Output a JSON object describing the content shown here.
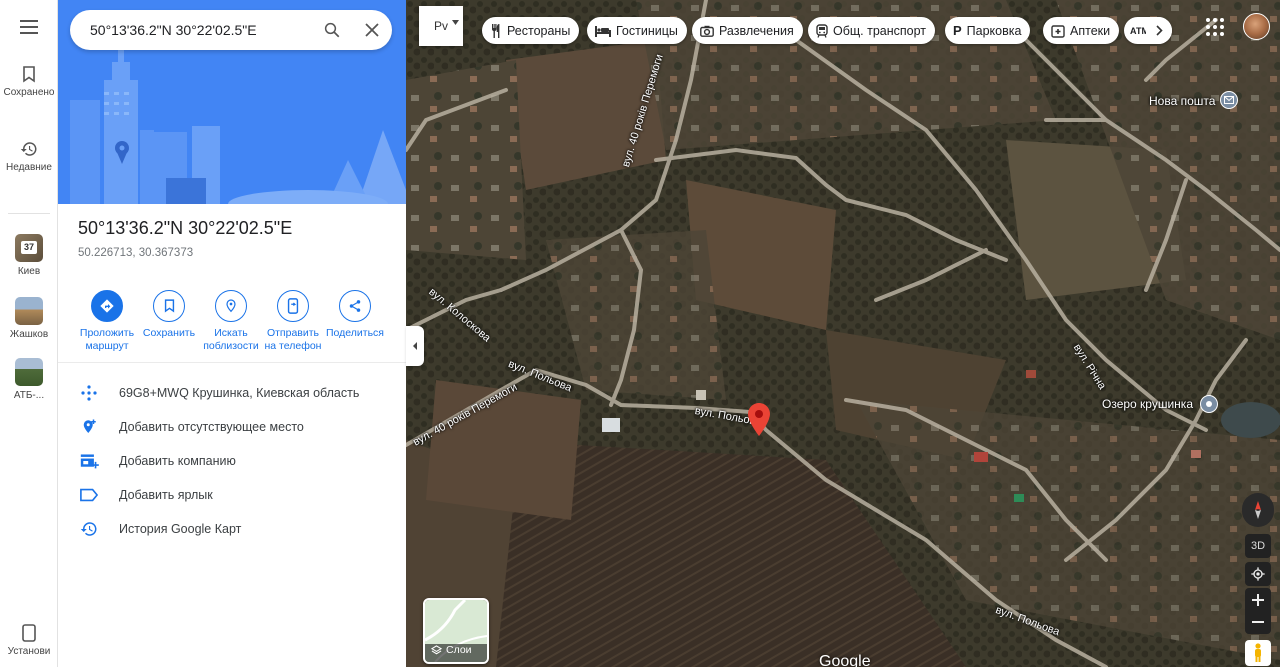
{
  "search": {
    "value": "50°13'36.2\"N 30°22'02.5\"E"
  },
  "rail": {
    "saved_label": "Сохранено",
    "recent_label": "Недавние",
    "history": [
      {
        "label": "Киев",
        "badge": "37"
      },
      {
        "label": "Жашков"
      },
      {
        "label": "АТБ-..."
      }
    ],
    "install_label": "Установи"
  },
  "place": {
    "title": "50°13'36.2\"N 30°22'02.5\"E",
    "coords": "50.226713, 30.367373"
  },
  "actions": [
    {
      "label": "Проложить маршрут",
      "icon": "directions-icon"
    },
    {
      "label": "Сохранить",
      "icon": "bookmark-icon"
    },
    {
      "label": "Искать поблизости",
      "icon": "nearby-icon"
    },
    {
      "label": "Отправить на телефон",
      "icon": "send-to-phone-icon"
    },
    {
      "label": "Поделиться",
      "icon": "share-icon"
    }
  ],
  "list": [
    {
      "text": "69G8+MWQ Крушинка, Киевская область",
      "icon": "plus-code-icon"
    },
    {
      "text": "Добавить отсутствующее место",
      "icon": "add-place-icon"
    },
    {
      "text": "Добавить компанию",
      "icon": "add-business-icon"
    },
    {
      "text": "Добавить ярлык",
      "icon": "label-icon"
    },
    {
      "text": "История Google Карт",
      "icon": "history-icon"
    }
  ],
  "map": {
    "layer_dropdown": "Рv",
    "chips": [
      {
        "label": "Рестораны",
        "icon": "restaurant-icon"
      },
      {
        "label": "Гостиницы",
        "icon": "hotel-icon"
      },
      {
        "label": "Развлечения",
        "icon": "camera-icon"
      },
      {
        "label": "Общ. транспорт",
        "icon": "transit-icon"
      },
      {
        "label": "Парковка",
        "icon": "parking-icon"
      },
      {
        "label": "Аптеки",
        "icon": "pharmacy-icon"
      },
      {
        "label": "АТМ",
        "icon": "atm-icon"
      }
    ],
    "labels": {
      "nova_poshta": "Нова пошта",
      "ozero": "Озеро крушинка",
      "street_pobedy_top": "вул. 40 років Перемоги",
      "street_pobedy_bottom": "вул. 40 років Перемоги",
      "street_kolosova": "вул. Колоскова",
      "street_polova_1": "вул. Польова",
      "street_polova_2": "вул. Польова",
      "street_polova_3": "вул. Польова",
      "street_richna": "вул. Річна"
    },
    "layers_label": "Слои",
    "btn_3d": "3D",
    "google": "Google"
  },
  "colors": {
    "accent": "#1a73e8",
    "pin": "#ea4335",
    "hero": "#3b78e7"
  }
}
